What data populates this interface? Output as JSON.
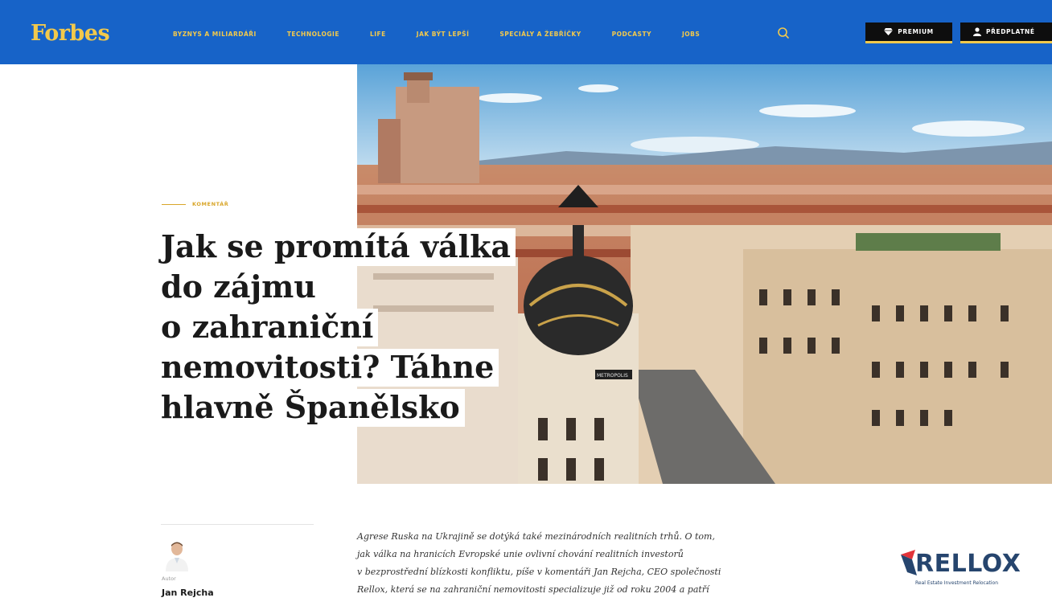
{
  "header": {
    "logo": "Forbes",
    "nav": [
      "BYZNYS A MILIARDÁŘI",
      "TECHNOLOGIE",
      "LIFE",
      "JAK BÝT LEPŠÍ",
      "SPECIÁLY A ŽEBŘÍČKY",
      "PODCASTY",
      "JOBS"
    ],
    "premium_label": "PREMIUM",
    "subscribe_label": "PŘEDPLATNÉ"
  },
  "article": {
    "category": "KOMENTÁŘ",
    "headline_lines": [
      "Jak se promítá válka",
      "do zájmu",
      "o zahraniční",
      "nemovitosti? Táhne",
      "hlavně Španělsko"
    ],
    "hero_sign": "METROPOLIS",
    "author_label": "Autor",
    "author_name": "Jan Rejcha",
    "perex_lines": [
      "Agrese Ruska na Ukrajině se dotýká také mezinárodních realitních trhů. O tom,",
      "jak válka na hranicích Evropské unie ovlivní chování realitních investorů",
      "v bezprostřední blízkosti konfliktu, píše v komentáři Jan Rejcha, CEO společnosti",
      "Rellox, která se na zahraniční nemovitosti specializuje již od roku 2004 a patří"
    ]
  },
  "sponsor": {
    "name": "RELLOX",
    "tagline": "Real Estate Investment Relocation"
  },
  "colors": {
    "header_bg": "#1763c8",
    "accent_gold": "#f2c94c",
    "rellox_navy": "#26456e",
    "rellox_red": "#e2343a"
  },
  "icons": [
    "search-icon",
    "diamond-icon",
    "user-icon"
  ]
}
